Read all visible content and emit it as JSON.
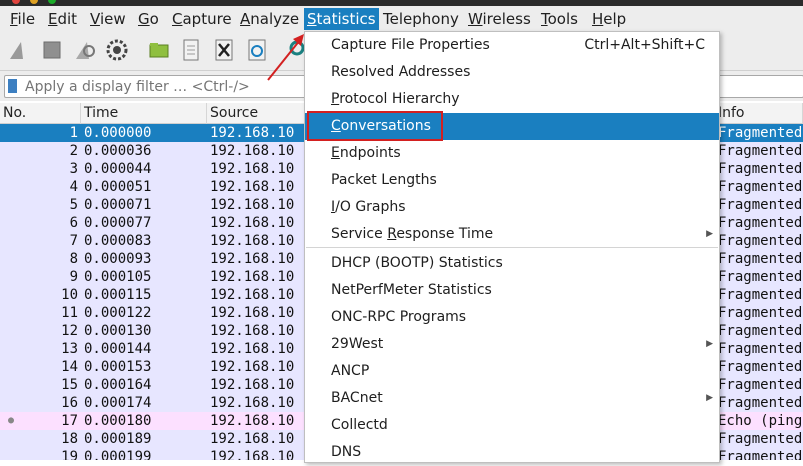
{
  "menubar": {
    "items": [
      {
        "label": "File",
        "u": "F",
        "rest": "ile"
      },
      {
        "label": "Edit",
        "u": "E",
        "rest": "dit"
      },
      {
        "label": "View",
        "u": "V",
        "rest": "iew"
      },
      {
        "label": "Go",
        "u": "G",
        "rest": "o"
      },
      {
        "label": "Capture",
        "u": "C",
        "rest": "apture"
      },
      {
        "label": "Analyze",
        "u": "A",
        "rest": "nalyze"
      },
      {
        "label": "Statistics",
        "u": "S",
        "rest": "tatistics"
      },
      {
        "label": "Telephony",
        "u": "y",
        "rest": ""
      },
      {
        "label": "Wireless",
        "u": "W",
        "rest": "ireless"
      },
      {
        "label": "Tools",
        "u": "T",
        "rest": "ools"
      },
      {
        "label": "Help",
        "u": "H",
        "rest": "elp"
      }
    ]
  },
  "filter": {
    "placeholder": "Apply a display filter … <Ctrl-/>"
  },
  "columns": {
    "no": "No.",
    "time": "Time",
    "source": "Source",
    "info": "Info"
  },
  "packets": [
    {
      "no": "1",
      "time": "0.000000",
      "src": "192.168.10",
      "info": "Fragmented"
    },
    {
      "no": "2",
      "time": "0.000036",
      "src": "192.168.10",
      "info": "Fragmented"
    },
    {
      "no": "3",
      "time": "0.000044",
      "src": "192.168.10",
      "info": "Fragmented"
    },
    {
      "no": "4",
      "time": "0.000051",
      "src": "192.168.10",
      "info": "Fragmented"
    },
    {
      "no": "5",
      "time": "0.000071",
      "src": "192.168.10",
      "info": "Fragmented"
    },
    {
      "no": "6",
      "time": "0.000077",
      "src": "192.168.10",
      "info": "Fragmented"
    },
    {
      "no": "7",
      "time": "0.000083",
      "src": "192.168.10",
      "info": "Fragmented"
    },
    {
      "no": "8",
      "time": "0.000093",
      "src": "192.168.10",
      "info": "Fragmented"
    },
    {
      "no": "9",
      "time": "0.000105",
      "src": "192.168.10",
      "info": "Fragmented"
    },
    {
      "no": "10",
      "time": "0.000115",
      "src": "192.168.10",
      "info": "Fragmented"
    },
    {
      "no": "11",
      "time": "0.000122",
      "src": "192.168.10",
      "info": "Fragmented"
    },
    {
      "no": "12",
      "time": "0.000130",
      "src": "192.168.10",
      "info": "Fragmented"
    },
    {
      "no": "13",
      "time": "0.000144",
      "src": "192.168.10",
      "info": "Fragmented"
    },
    {
      "no": "14",
      "time": "0.000153",
      "src": "192.168.10",
      "info": "Fragmented"
    },
    {
      "no": "15",
      "time": "0.000164",
      "src": "192.168.10",
      "info": "Fragmented"
    },
    {
      "no": "16",
      "time": "0.000174",
      "src": "192.168.10",
      "info": "Fragmented"
    },
    {
      "no": "17",
      "time": "0.000180",
      "src": "192.168.10",
      "info": "Echo (ping"
    },
    {
      "no": "18",
      "time": "0.000189",
      "src": "192.168.10",
      "info": "Fragmented"
    },
    {
      "no": "19",
      "time": "0.000199",
      "src": "192.168.10",
      "info": "Fragmented"
    }
  ],
  "statistics_menu": {
    "items": [
      {
        "label": "Capture File Properties",
        "pre": "Capture File Properties",
        "u": "",
        "post": "",
        "shortcut": "Ctrl+Alt+Shift+C",
        "submenu": false
      },
      {
        "label": "Resolved Addresses",
        "pre": "Resolved Addresses",
        "u": "",
        "post": "",
        "shortcut": "",
        "submenu": false
      },
      {
        "label": "Protocol Hierarchy",
        "pre": "",
        "u": "P",
        "post": "rotocol Hierarchy",
        "shortcut": "",
        "submenu": false
      },
      {
        "label": "Conversations",
        "pre": "",
        "u": "C",
        "post": "onversations",
        "shortcut": "",
        "submenu": false
      },
      {
        "label": "Endpoints",
        "pre": "",
        "u": "E",
        "post": "ndpoints",
        "shortcut": "",
        "submenu": false
      },
      {
        "label": "Packet Lengths",
        "pre": "Packet Lengths",
        "u": "",
        "post": "",
        "shortcut": "",
        "submenu": false
      },
      {
        "label": "I/O Graphs",
        "pre": "",
        "u": "I",
        "post": "/O Graphs",
        "shortcut": "",
        "submenu": false
      },
      {
        "label": "Service Response Time",
        "pre": "Service ",
        "u": "R",
        "post": "esponse Time",
        "shortcut": "",
        "submenu": true
      },
      {
        "label": "DHCP (BOOTP) Statistics",
        "pre": "DHCP (BOOTP) Statistics",
        "u": "",
        "post": "",
        "shortcut": "",
        "submenu": false
      },
      {
        "label": "NetPerfMeter Statistics",
        "pre": "NetPerfMeter Statistics",
        "u": "",
        "post": "",
        "shortcut": "",
        "submenu": false
      },
      {
        "label": "ONC-RPC Programs",
        "pre": "ONC-RPC Programs",
        "u": "",
        "post": "",
        "shortcut": "",
        "submenu": false
      },
      {
        "label": "29West",
        "pre": "29West",
        "u": "",
        "post": "",
        "shortcut": "",
        "submenu": true
      },
      {
        "label": "ANCP",
        "pre": "ANCP",
        "u": "",
        "post": "",
        "shortcut": "",
        "submenu": false
      },
      {
        "label": "BACnet",
        "pre": "BACnet",
        "u": "",
        "post": "",
        "shortcut": "",
        "submenu": true
      },
      {
        "label": "Collectd",
        "pre": "Collectd",
        "u": "",
        "post": "",
        "shortcut": "",
        "submenu": false
      },
      {
        "label": "DNS",
        "pre": "DNS",
        "u": "",
        "post": "",
        "shortcut": "",
        "submenu": false
      }
    ]
  },
  "colors": {
    "selection": "#1a7fc0",
    "annotation": "#d32020",
    "row_default": "#e7e6ff",
    "row_ping": "#fce0ff"
  }
}
